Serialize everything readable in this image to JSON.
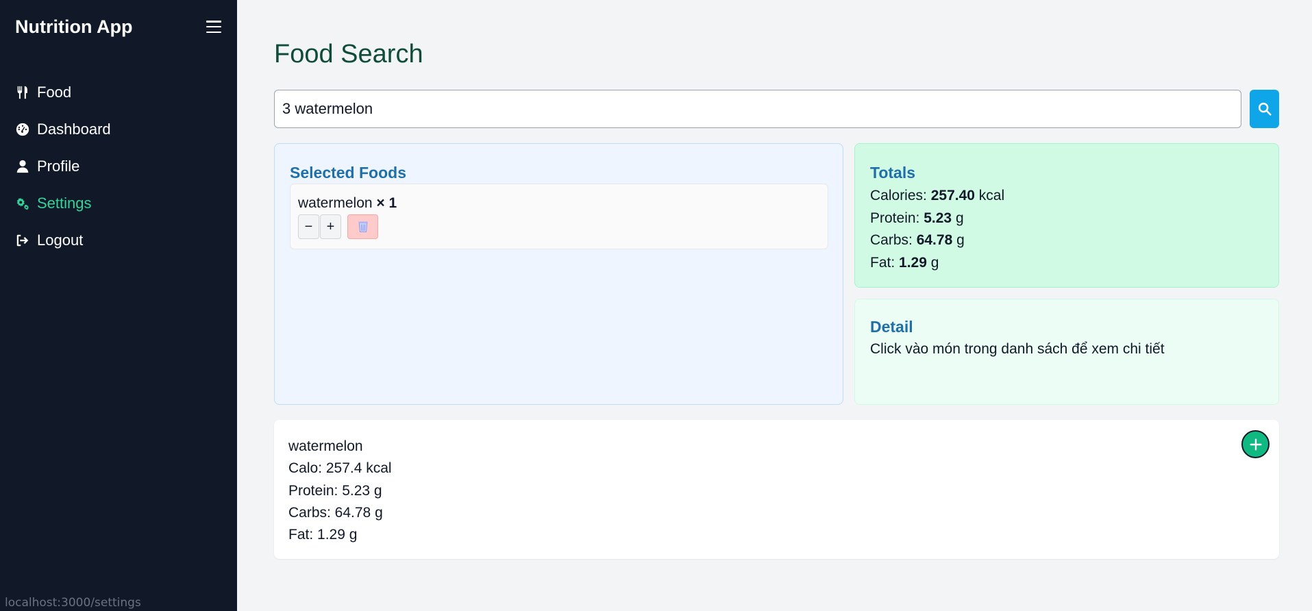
{
  "sidebar": {
    "app_title": "Nutrition App",
    "menu_icon": "hamburger-icon",
    "items": [
      {
        "label": "Food",
        "icon": "utensils-icon",
        "active": false
      },
      {
        "label": "Dashboard",
        "icon": "gauge-icon",
        "active": false
      },
      {
        "label": "Profile",
        "icon": "user-icon",
        "active": false
      },
      {
        "label": "Settings",
        "icon": "gears-icon",
        "active": true
      },
      {
        "label": "Logout",
        "icon": "logout-icon",
        "active": false
      }
    ],
    "active_color": "#34d399"
  },
  "status_bar": {
    "url": "localhost:3000/settings"
  },
  "main": {
    "title": "Food Search",
    "search": {
      "value": "3 watermelon",
      "button_icon": "search-icon"
    },
    "selected_foods": {
      "title": "Selected Foods",
      "items": [
        {
          "name": "watermelon",
          "quantity_text": "× 1",
          "minus_label": "−",
          "plus_label": "+",
          "delete_icon": "trash-icon"
        }
      ]
    },
    "totals": {
      "title": "Totals",
      "calories": {
        "label": "Calories:",
        "value": "257.40",
        "unit": "kcal"
      },
      "protein": {
        "label": "Protein:",
        "value": "5.23",
        "unit": "g"
      },
      "carbs": {
        "label": "Carbs:",
        "value": "64.78",
        "unit": "g"
      },
      "fat": {
        "label": "Fat:",
        "value": "1.29",
        "unit": "g"
      }
    },
    "detail": {
      "title": "Detail",
      "text": "Click vào món trong danh sách để xem chi tiết"
    },
    "result": {
      "name": "watermelon",
      "calories": "Calo: 257.4 kcal",
      "protein": "Protein: 5.23 g",
      "carbs": "Carbs: 64.78 g",
      "fat": "Fat: 1.29 g",
      "add_icon": "plus-circle-icon"
    }
  },
  "colors": {
    "sidebar_bg": "#111827",
    "accent_blue": "#0ea5e9",
    "panel_title": "#1f6fa8",
    "add_green": "#10b981"
  }
}
